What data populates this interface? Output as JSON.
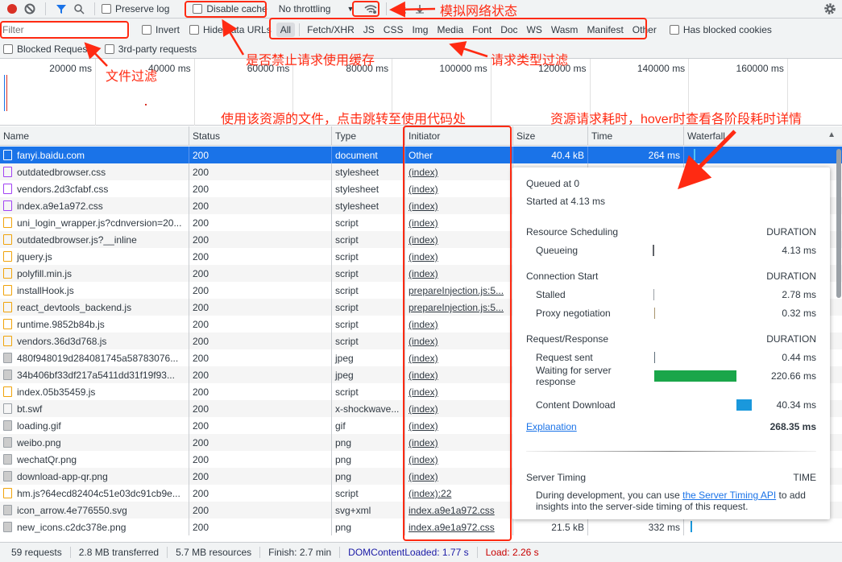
{
  "toolbar": {
    "preserve_log": "Preserve log",
    "disable_cache": "Disable cache",
    "throttling": "No throttling",
    "icons": [
      "record-icon",
      "clear-icon",
      "filter-icon",
      "search-icon",
      "network-conditions-icon",
      "import-icon",
      "export-icon",
      "settings-icon"
    ]
  },
  "filterbar": {
    "placeholder": "Filter",
    "invert": "Invert",
    "hide_data_urls": "Hide data URLs",
    "types": [
      "All",
      "Fetch/XHR",
      "JS",
      "CSS",
      "Img",
      "Media",
      "Font",
      "Doc",
      "WS",
      "Wasm",
      "Manifest",
      "Other"
    ],
    "active_type": "All",
    "has_blocked_cookies": "Has blocked cookies",
    "blocked_requests": "Blocked Requests",
    "third_party": "3rd-party requests"
  },
  "overview": {
    "ticks": [
      "20000 ms",
      "40000 ms",
      "60000 ms",
      "80000 ms",
      "100000 ms",
      "120000 ms",
      "140000 ms",
      "160000 ms"
    ]
  },
  "columns": {
    "name": "Name",
    "status": "Status",
    "type": "Type",
    "initiator": "Initiator",
    "size": "Size",
    "time": "Time",
    "waterfall": "Waterfall"
  },
  "rows": [
    {
      "name": "fanyi.baidu.com",
      "status": "200",
      "type": "document",
      "initiator": "Other",
      "size": "40.4 kB",
      "time": "264 ms",
      "icon": "document"
    },
    {
      "name": "outdatedbrowser.css",
      "status": "200",
      "type": "stylesheet",
      "initiator": "(index)",
      "icon": "css"
    },
    {
      "name": "vendors.2d3cfabf.css",
      "status": "200",
      "type": "stylesheet",
      "initiator": "(index)",
      "icon": "css"
    },
    {
      "name": "index.a9e1a972.css",
      "status": "200",
      "type": "stylesheet",
      "initiator": "(index)",
      "icon": "css"
    },
    {
      "name": "uni_login_wrapper.js?cdnversion=20...",
      "status": "200",
      "type": "script",
      "initiator": "(index)",
      "icon": "script"
    },
    {
      "name": "outdatedbrowser.js?__inline",
      "status": "200",
      "type": "script",
      "initiator": "(index)",
      "icon": "script"
    },
    {
      "name": "jquery.js",
      "status": "200",
      "type": "script",
      "initiator": "(index)",
      "icon": "script"
    },
    {
      "name": "polyfill.min.js",
      "status": "200",
      "type": "script",
      "initiator": "(index)",
      "icon": "script"
    },
    {
      "name": "installHook.js",
      "status": "200",
      "type": "script",
      "initiator": "prepareInjection.js:5...",
      "icon": "script"
    },
    {
      "name": "react_devtools_backend.js",
      "status": "200",
      "type": "script",
      "initiator": "prepareInjection.js:5...",
      "icon": "script"
    },
    {
      "name": "runtime.9852b84b.js",
      "status": "200",
      "type": "script",
      "initiator": "(index)",
      "icon": "script"
    },
    {
      "name": "vendors.36d3d768.js",
      "status": "200",
      "type": "script",
      "initiator": "(index)",
      "icon": "script"
    },
    {
      "name": "480f948019d284081745a58783076...",
      "status": "200",
      "type": "jpeg",
      "initiator": "(index)",
      "icon": "image"
    },
    {
      "name": "34b406bf33df217a5411dd31f19f93...",
      "status": "200",
      "type": "jpeg",
      "initiator": "(index)",
      "icon": "image"
    },
    {
      "name": "index.05b35459.js",
      "status": "200",
      "type": "script",
      "initiator": "(index)",
      "icon": "script"
    },
    {
      "name": "bt.swf",
      "status": "200",
      "type": "x-shockwave...",
      "initiator": "(index)",
      "icon": "file"
    },
    {
      "name": "loading.gif",
      "status": "200",
      "type": "gif",
      "initiator": "(index)",
      "icon": "image"
    },
    {
      "name": "weibo.png",
      "status": "200",
      "type": "png",
      "initiator": "(index)",
      "icon": "image"
    },
    {
      "name": "wechatQr.png",
      "status": "200",
      "type": "png",
      "initiator": "(index)",
      "icon": "image"
    },
    {
      "name": "download-app-qr.png",
      "status": "200",
      "type": "png",
      "initiator": "(index)",
      "icon": "image"
    },
    {
      "name": "hm.js?64ecd82404c51e03dc91cb9e...",
      "status": "200",
      "type": "script",
      "initiator": "(index):22",
      "icon": "script"
    },
    {
      "name": "icon_arrow.4e776550.svg",
      "status": "200",
      "type": "svg+xml",
      "initiator": "index.a9e1a972.css",
      "icon": "image"
    },
    {
      "name": "new_icons.c2dc378e.png",
      "status": "200",
      "type": "png",
      "initiator": "index.a9e1a972.css",
      "size": "21.5 kB",
      "time": "332 ms",
      "icon": "image"
    }
  ],
  "timing": {
    "queued": "Queued at 0",
    "started": "Started at 4.13 ms",
    "duration_label": "DURATION",
    "sections": [
      {
        "title": "Resource Scheduling",
        "items": [
          {
            "label": "Queueing",
            "value": "4.13 ms"
          }
        ]
      },
      {
        "title": "Connection Start",
        "items": [
          {
            "label": "Stalled",
            "value": "2.78 ms"
          },
          {
            "label": "Proxy negotiation",
            "value": "0.32 ms"
          }
        ]
      },
      {
        "title": "Request/Response",
        "items": [
          {
            "label": "Request sent",
            "value": "0.44 ms"
          },
          {
            "label": "Waiting for server response",
            "value": "220.66 ms"
          },
          {
            "label": "Content Download",
            "value": "40.34 ms"
          }
        ]
      }
    ],
    "explanation": "Explanation",
    "total": "268.35 ms",
    "server_timing": "Server Timing",
    "time_label": "TIME",
    "server_text_1": "During development, you can use ",
    "server_link": "the Server Timing API",
    "server_text_2": " to add insights into the server-side timing of this request.",
    "colors": {
      "waiting": "#1aa64a",
      "download": "#1a98dc"
    }
  },
  "footer": {
    "requests": "59 requests",
    "transferred": "2.8 MB transferred",
    "resources": "5.7 MB resources",
    "finish": "Finish: 2.7 min",
    "dcl": "DOMContentLoaded: 1.77 s",
    "load": "Load: 2.26 s"
  },
  "annotations": {
    "network": "模拟网络状态",
    "cache": "是否禁止请求使用缓存",
    "types": "请求类型过滤",
    "filter": "文件过滤",
    "initiator": "使用该资源的文件，点击跳转至使用代码处",
    "time": "资源请求耗时，hover时查看各阶段耗时详情",
    "color": "#ff2a12"
  }
}
